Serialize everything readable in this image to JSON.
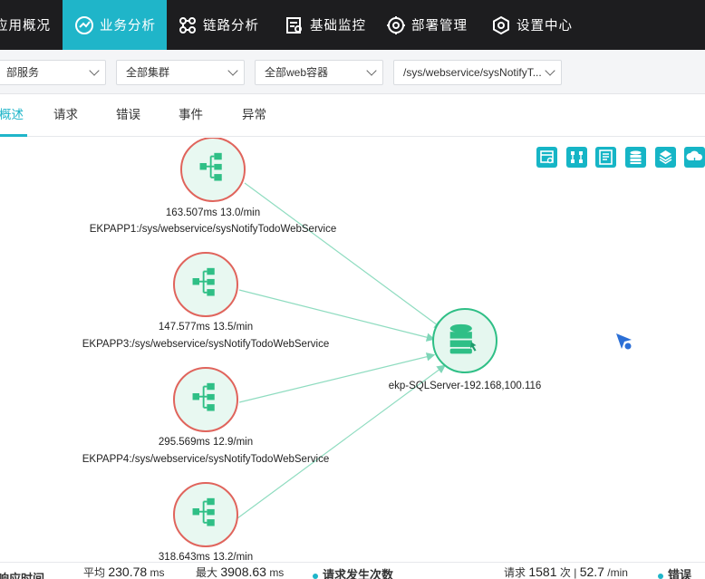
{
  "nav": {
    "items": [
      {
        "label": "应用概况",
        "icon": "app-overview-icon"
      },
      {
        "label": "业务分析",
        "icon": "business-analysis-icon",
        "active": true
      },
      {
        "label": "链路分析",
        "icon": "trace-analysis-icon"
      },
      {
        "label": "基础监控",
        "icon": "basic-monitor-icon"
      },
      {
        "label": "部署管理",
        "icon": "deploy-manage-icon"
      },
      {
        "label": "设置中心",
        "icon": "settings-icon"
      }
    ],
    "active_color": "#1fb5c9"
  },
  "filters": {
    "service": "部服务",
    "cluster": "全部集群",
    "container": "全部web容器",
    "path": "/sys/webservice/sysNotifyT..."
  },
  "tabs": [
    {
      "label": "概述",
      "active": true
    },
    {
      "label": "请求"
    },
    {
      "label": "错误"
    },
    {
      "label": "事件"
    },
    {
      "label": "异常"
    }
  ],
  "toolbar": [
    "layout-icon",
    "tree-icon",
    "list-icon",
    "database-icon",
    "layers-icon",
    "cloud-icon"
  ],
  "graph": {
    "sources": [
      {
        "metrics": "163.507ms 13.0/min",
        "name": "EKPAPP1:/sys/webservice/sysNotifyTodoWebService"
      },
      {
        "metrics": "147.577ms 13.5/min",
        "name": "EKPAPP3:/sys/webservice/sysNotifyTodoWebService"
      },
      {
        "metrics": "295.569ms 12.9/min",
        "name": "EKPAPP4:/sys/webservice/sysNotifyTodoWebService"
      },
      {
        "metrics": "318.643ms 13.2/min",
        "name": ""
      }
    ],
    "target": {
      "name": "ekp-SQLServer-192.168,100.116"
    }
  },
  "stats": {
    "resp_title": "响应时间",
    "avg_label": "平均",
    "avg_value": "230.78",
    "avg_unit": "ms",
    "max_label": "最大",
    "max_value": "3908.63",
    "max_unit": "ms",
    "req_title": "请求发生次数",
    "req_label": "请求",
    "req_count": "1581",
    "req_count_unit": "次",
    "req_rate": "52.7",
    "req_rate_unit": "/min",
    "err_title": "错误"
  }
}
